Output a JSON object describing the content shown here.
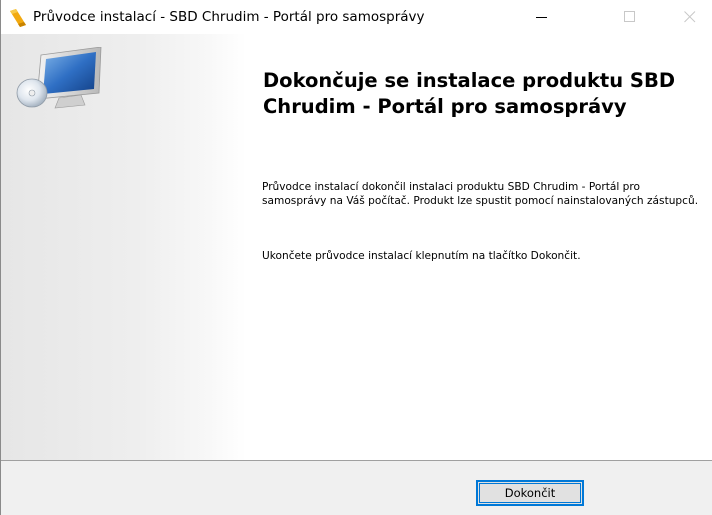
{
  "window": {
    "title": "Průvodce instalací - SBD Chrudim - Portál pro samosprávy",
    "app_icon": "installer-icon",
    "controls": {
      "minimize_icon": "minimize-icon",
      "maximize_icon": "maximize-icon",
      "close_icon": "close-icon"
    }
  },
  "side_graphic": "computer-monitor-icon",
  "main": {
    "heading": "Dokončuje se instalace produktu SBD Chrudim - Portál pro samosprávy",
    "paragraph1": "Průvodce instalací dokončil instalaci produktu SBD Chrudim - Portál pro samosprávy na Váš počítač. Produkt lze spustit pomocí nainstalovaných zástupců.",
    "paragraph2": "Ukončete průvodce instalací klepnutím na tlačítko Dokončit."
  },
  "footer": {
    "finish_label": "Dokončit"
  },
  "colors": {
    "accent": "#0078d7",
    "footer_bg": "#f0f0f0",
    "button_bg": "#e1e1e1"
  }
}
